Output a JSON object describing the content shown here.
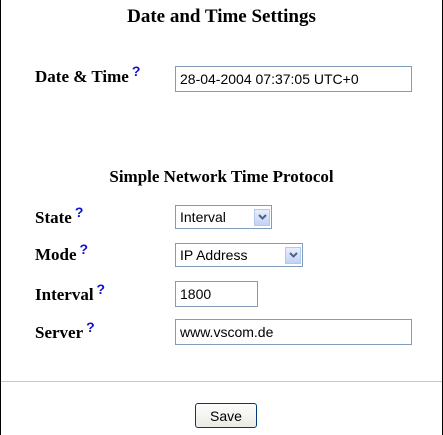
{
  "page": {
    "title": "Date and Time Settings",
    "help_glyph": "?"
  },
  "date_time": {
    "label": "Date & Time",
    "value": "28-04-2004 07:37:05 UTC+0"
  },
  "sntp": {
    "section_title": "Simple Network Time Protocol",
    "state": {
      "label": "State",
      "selected": "Interval"
    },
    "mode": {
      "label": "Mode",
      "selected": "IP Address"
    },
    "interval": {
      "label": "Interval",
      "value": "1800"
    },
    "server": {
      "label": "Server",
      "value": "www.vscom.de"
    }
  },
  "actions": {
    "save_label": "Save"
  },
  "colors": {
    "help_icon": "#1010d0",
    "field_border": "#7f9db9",
    "button_border": "#003c74"
  },
  "icons": {
    "help": "help-question-icon",
    "dropdown": "chevron-down-icon"
  }
}
